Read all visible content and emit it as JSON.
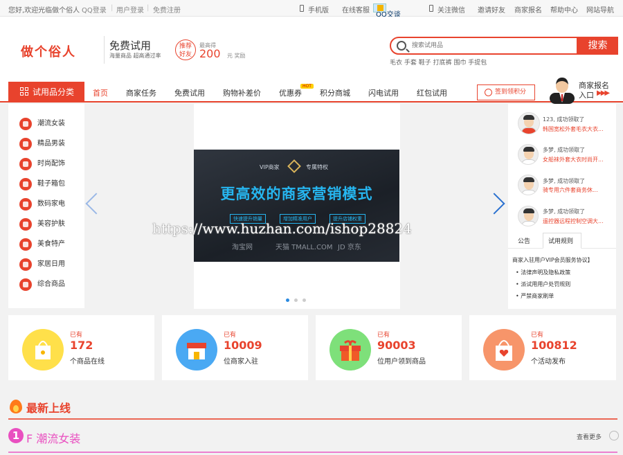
{
  "topbar": {
    "welcome": "您好,欢迎光临做个俗人",
    "qq_login": "QQ登录",
    "user_login": "用户登录",
    "register": "免费注册",
    "mobile": "手机版",
    "online_service": "在线客服",
    "qq_chat": "QQ交谈",
    "wechat": "关注微信",
    "invite": "邀请好友",
    "merchant_signup": "商家报名",
    "help": "帮助中心",
    "site_nav": "网站导航"
  },
  "header": {
    "logo": "做个俗人",
    "free_trial": "免费试用",
    "free_trial_sub": "海量商品 超高通过率",
    "recommend": "推荐\n好友",
    "max_label": "最高得",
    "max_value": "200",
    "max_unit": "元 奖励"
  },
  "search": {
    "placeholder": "搜索试用品",
    "button": "搜索",
    "hotwords": "毛衣 手套 鞋子 打底裤 围巾 手提包"
  },
  "nav": {
    "category": "试用品分类",
    "items": [
      "首页",
      "商家任务",
      "免费试用",
      "购物补差价",
      "优惠券",
      "积分商城",
      "闪电试用",
      "红包试用"
    ],
    "hot_badge": "HOT",
    "sign_in": "签到领积分",
    "merchant_line1": "商家报名",
    "merchant_line2": "入口"
  },
  "sidebar": {
    "items": [
      "潮流女装",
      "精品男装",
      "时尚配饰",
      "鞋子箱包",
      "数码家电",
      "美容护肤",
      "美食特产",
      "家居日用",
      "综合商品"
    ]
  },
  "banner": {
    "vip": "VIP商家",
    "privilege": "专属特权",
    "headline": "更高效的商家营销模式",
    "tags": [
      "快速提升销量",
      "增加精准用户",
      "提升店铺权重"
    ],
    "logos": [
      "淘宝网",
      "天猫 TMALL.COM",
      "JD 京东"
    ],
    "watermark": "https://www.huzhan.com/ishop28824"
  },
  "winners": [
    {
      "name": "123, 成功领取了",
      "product": "韩国宽松外套毛衣大衣..."
    },
    {
      "name": "多梦, 成功领取了",
      "product": "女船袜外套大衣时尚开..."
    },
    {
      "name": "多梦, 成功领取了",
      "product": "骑专用六件套商务休..."
    },
    {
      "name": "多梦, 成功领取了",
      "product": "遥控器远程控制空调大..."
    }
  ],
  "tabs": {
    "notice": "公告",
    "rules": "试用规则"
  },
  "notices": [
    "商家入驻用户VIP会员服务协议】",
    "法律声明及隐私政策",
    "派试用用户处罚规则",
    "严禁商家刷单"
  ],
  "stats": [
    {
      "has": "已有",
      "num": "172",
      "label": "个商品在线",
      "color": "#ffe04a"
    },
    {
      "has": "已有",
      "num": "10009",
      "label": "位商家入驻",
      "color": "#4aa9f3"
    },
    {
      "has": "已有",
      "num": "90003",
      "label": "位用户领到商品",
      "color": "#7ee07a"
    },
    {
      "has": "已有",
      "num": "100812",
      "label": "个活动发布",
      "color": "#f7956a"
    }
  ],
  "sections": {
    "new_title": "最新上线",
    "floor_num": "1",
    "floor_title": "F 潮流女装",
    "more": "查看更多"
  },
  "colors": {
    "accent": "#e8432d",
    "floor": "#e94fc0"
  }
}
